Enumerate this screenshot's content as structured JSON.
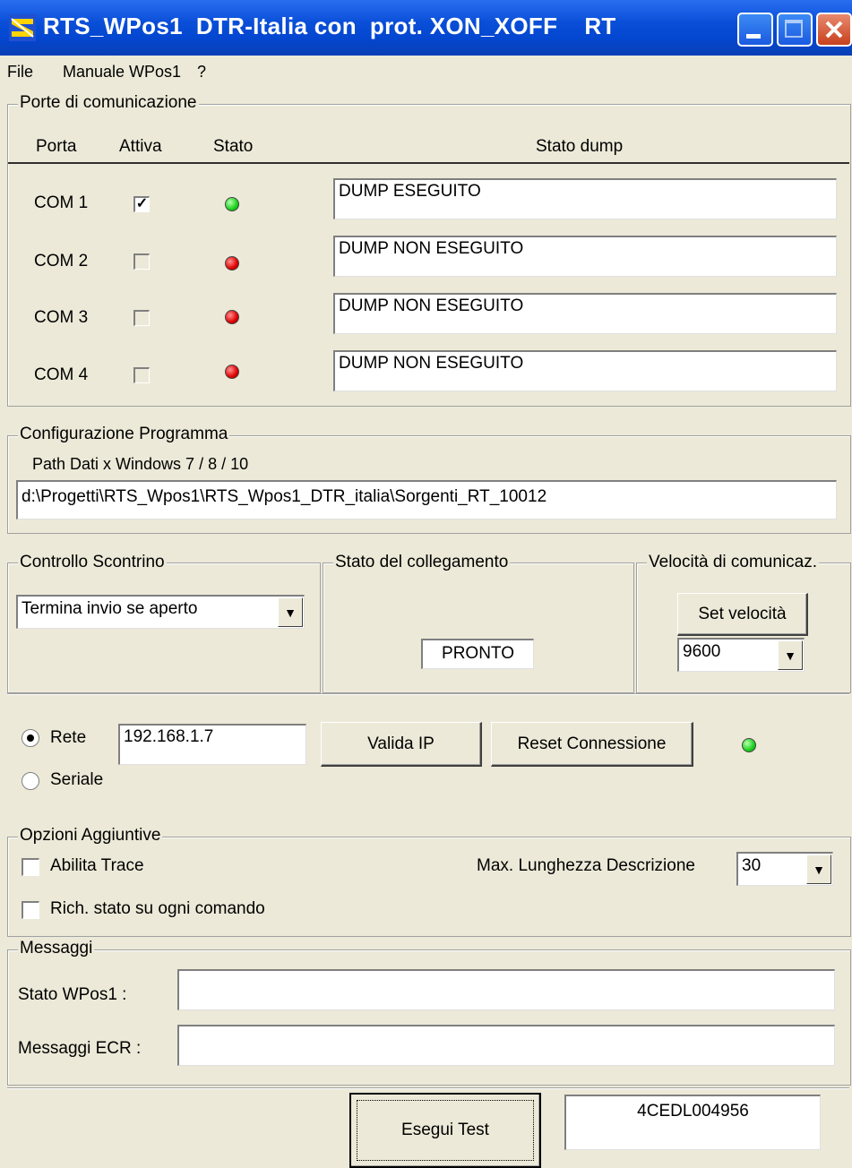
{
  "window": {
    "title": "RTS_WPos1  DTR-Italia con  prot. XON_XOFF    RT"
  },
  "menu": [
    "File",
    "Manuale WPos1",
    "?"
  ],
  "ports": {
    "group_label": "Porte di comunicazione",
    "headers": {
      "port": "Porta",
      "active": "Attiva",
      "status": "Stato",
      "dump": "Stato dump"
    },
    "rows": [
      {
        "name": "COM 1",
        "active": "✓",
        "led": "green",
        "dump": "DUMP ESEGUITO"
      },
      {
        "name": "COM 2",
        "active": "",
        "led": "red",
        "dump": "DUMP NON ESEGUITO"
      },
      {
        "name": "COM 3",
        "active": "",
        "led": "red",
        "dump": "DUMP NON ESEGUITO"
      },
      {
        "name": "COM 4",
        "active": "",
        "led": "red",
        "dump": "DUMP NON ESEGUITO"
      }
    ]
  },
  "config": {
    "group_label": "Configurazione Programma",
    "path_label": "Path Dati x Windows  7 / 8 / 10",
    "path_value": "d:\\Progetti\\RTS_Wpos1\\RTS_Wpos1_DTR_italia\\Sorgenti_RT_10012"
  },
  "receipt": {
    "group_label": "Controllo Scontrino",
    "selected": "Termina invio se aperto"
  },
  "link": {
    "group_label": "Stato del collegamento",
    "status": "PRONTO"
  },
  "speed": {
    "group_label": "Velocità di comunicaz.",
    "set_button": "Set velocità",
    "selected": "9600"
  },
  "network": {
    "rete_label": "Rete",
    "seriale_label": "Seriale",
    "ip": "192.168.1.7",
    "validate_button": "Valida IP",
    "reset_button": "Reset Connessione",
    "selected_mode": "Rete"
  },
  "options": {
    "group_label": "Opzioni Aggiuntive",
    "trace_label": "Abilita Trace",
    "status_each_label": "Rich. stato su ogni comando",
    "maxlen_label": "Max. Lunghezza Descrizione",
    "maxlen_value": "30"
  },
  "messages": {
    "group_label": "Messaggi",
    "wpos_label": "Stato  WPos1 :",
    "wpos_value": "",
    "ecr_label": "Messaggi ECR :",
    "ecr_value": ""
  },
  "footer": {
    "test_button": "Esegui Test",
    "serial": "4CEDL004956"
  },
  "colors": {
    "titlebar": "#0a4fd8",
    "background": "#ece9d8",
    "led_green": "#19d11a",
    "led_red": "#e00000"
  }
}
